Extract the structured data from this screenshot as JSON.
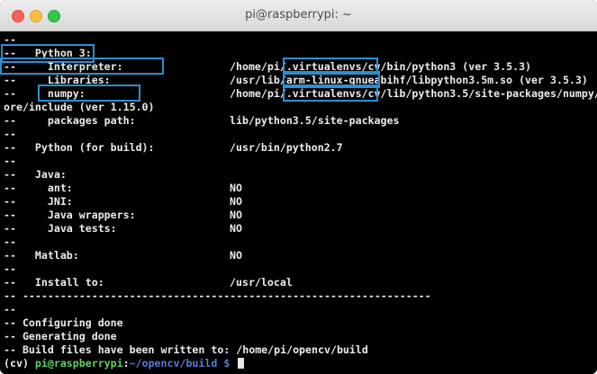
{
  "window": {
    "title": "pi@raspberrypi: ~"
  },
  "terminal": {
    "lines": [
      {
        "col1": "--",
        "col2": ""
      },
      {
        "col1": "--   Python 3:",
        "col2": ""
      },
      {
        "col1": "--     Interpreter:",
        "col2": "/home/pi/.virtualenvs/cv/bin/python3 (ver 3.5.3)"
      },
      {
        "col1": "--     Libraries:",
        "col2": "/usr/lib/arm-linux-gnueabihf/libpython3.5m.so (ver 3.5.3)"
      },
      {
        "col1": "--     numpy:",
        "col2": "/home/pi/.virtualenvs/cv/lib/python3.5/site-packages/numpy/c"
      },
      {
        "col1": "ore/include (ver 1.15.0)",
        "col2": ""
      },
      {
        "col1": "--     packages path:",
        "col2": "lib/python3.5/site-packages"
      },
      {
        "col1": "--",
        "col2": ""
      },
      {
        "col1": "--   Python (for build):",
        "col2": "/usr/bin/python2.7"
      },
      {
        "col1": "--",
        "col2": ""
      },
      {
        "col1": "--   Java:",
        "col2": ""
      },
      {
        "col1": "--     ant:",
        "col2": "NO"
      },
      {
        "col1": "--     JNI:",
        "col2": "NO"
      },
      {
        "col1": "--     Java wrappers:",
        "col2": "NO"
      },
      {
        "col1": "--     Java tests:",
        "col2": "NO"
      },
      {
        "col1": "--",
        "col2": ""
      },
      {
        "col1": "--   Matlab:",
        "col2": "NO"
      },
      {
        "col1": "--",
        "col2": ""
      },
      {
        "col1": "--   Install to:",
        "col2": "/usr/local"
      },
      {
        "col1": "-- -----------------------------------------------------------------",
        "col2": ""
      },
      {
        "col1": "--",
        "col2": ""
      },
      {
        "col1": "-- Configuring done",
        "col2": ""
      },
      {
        "col1": "-- Generating done",
        "col2": ""
      },
      {
        "col1": "-- Build files have been written to: /home/pi/opencv/build",
        "col2": ""
      }
    ],
    "prompt": {
      "env": "(cv) ",
      "user_host": "pi@raspberrypi",
      "sep": ":",
      "path": "~/opencv/build $",
      "trailing": " "
    }
  },
  "colors": {
    "highlight": "#2c8fd3",
    "prompt_user": "#5ed35e",
    "prompt_path": "#5b7bd8"
  }
}
